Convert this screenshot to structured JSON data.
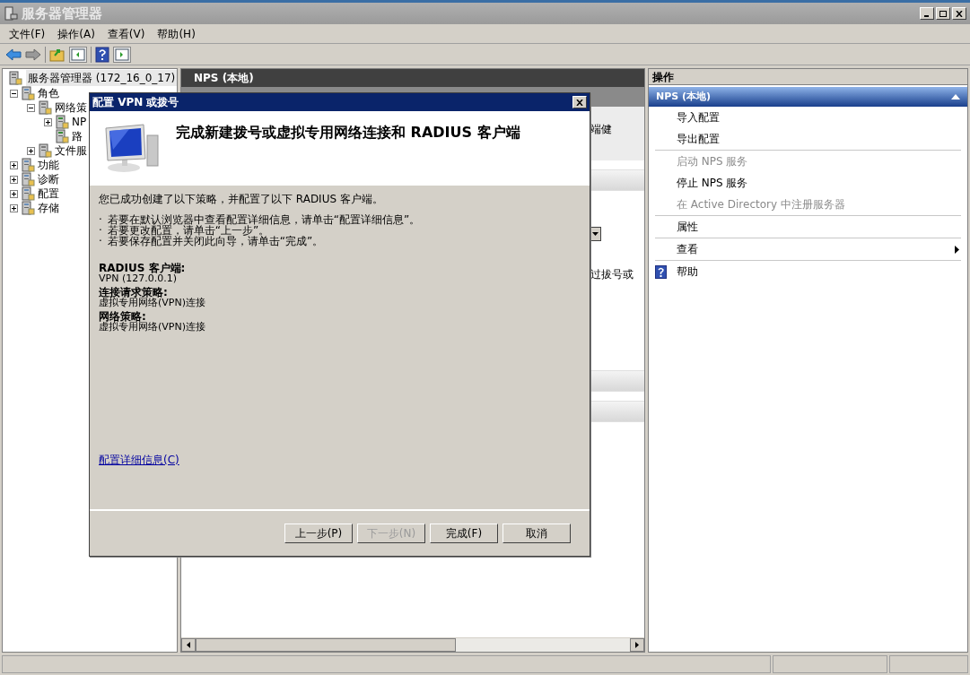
{
  "window": {
    "title": "服务器管理器"
  },
  "menu": [
    "文件(F)",
    "操作(A)",
    "查看(V)",
    "帮助(H)"
  ],
  "tree": {
    "root": "服务器管理器 (172_16_0_17)",
    "items": [
      {
        "label": "角色",
        "expanded": true,
        "children": [
          {
            "label": "网络策",
            "expanded": true,
            "children": [
              {
                "label": "NP",
                "expanded": false
              },
              {
                "label": "路"
              }
            ]
          },
          {
            "label": "文件服",
            "expanded": false
          }
        ]
      },
      {
        "label": "功能",
        "expanded": false
      },
      {
        "label": "诊断",
        "expanded": false
      },
      {
        "label": "配置",
        "expanded": false
      },
      {
        "label": "存储",
        "expanded": false
      }
    ]
  },
  "middle": {
    "header": "NPS (本地)",
    "fragments": [
      "端健",
      "过拔号或"
    ]
  },
  "actions": {
    "title": "操作",
    "section": {
      "title": "NPS (本地)",
      "expanded": true
    },
    "groups": [
      [
        {
          "label": "导入配置",
          "disabled": false,
          "kind": "item"
        },
        {
          "label": "导出配置",
          "disabled": false,
          "kind": "item"
        }
      ],
      [
        {
          "label": "启动 NPS 服务",
          "disabled": true,
          "kind": "item"
        },
        {
          "label": "停止 NPS 服务",
          "disabled": false,
          "kind": "item"
        },
        {
          "label": "在 Active Directory 中注册服务器",
          "disabled": true,
          "kind": "item"
        }
      ],
      [
        {
          "label": "属性",
          "disabled": false,
          "kind": "item"
        }
      ],
      [
        {
          "label": "查看",
          "disabled": false,
          "kind": "submenu"
        }
      ],
      [
        {
          "label": "帮助",
          "disabled": false,
          "kind": "help"
        }
      ]
    ]
  },
  "dialog": {
    "title": "配置 VPN 或拨号",
    "heading": "完成新建拨号或虚拟专用网络连接和 RADIUS 客户端",
    "intro": "您已成功创建了以下策略，并配置了以下 RADIUS 客户端。",
    "bullets": [
      "若要在默认浏览器中查看配置详细信息，请单击“配置详细信息”。",
      "若要更改配置，请单击“上一步”。",
      "若要保存配置并关闭此向导，请单击“完成”。"
    ],
    "bullet_mark": "·",
    "sections": [
      {
        "label": "RADIUS 客户端:",
        "value": "VPN (127.0.0.1)"
      },
      {
        "label": "连接请求策略:",
        "value": "虚拟专用网络(VPN)连接"
      },
      {
        "label": "网络策略:",
        "value": "虚拟专用网络(VPN)连接"
      }
    ],
    "link": "配置详细信息(C)",
    "buttons": [
      {
        "label": "上一步(P)",
        "disabled": false
      },
      {
        "label": "下一步(N)",
        "disabled": true
      },
      {
        "label": "完成(F)",
        "disabled": false
      },
      {
        "label": "取消",
        "disabled": false
      }
    ]
  }
}
